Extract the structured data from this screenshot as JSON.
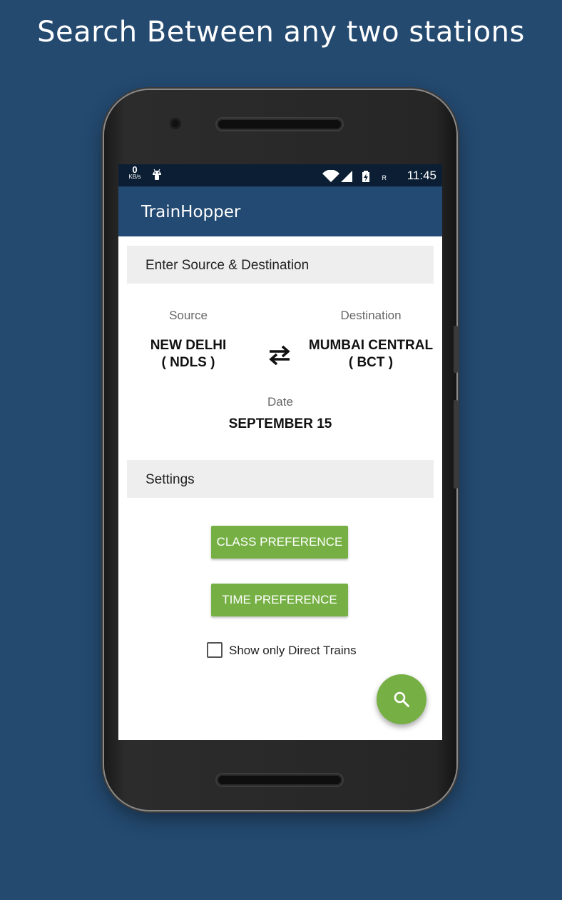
{
  "headline": "Search Between any two stations",
  "status_bar": {
    "data_rate_value": "0",
    "data_rate_unit": "KB/s",
    "network_label": "R",
    "time": "11:45"
  },
  "app_bar": {
    "title": "TrainHopper"
  },
  "route_section": {
    "header": "Enter Source & Destination",
    "source_label": "Source",
    "source_station": "NEW DELHI",
    "source_code": "( NDLS )",
    "destination_label": "Destination",
    "destination_station": "MUMBAI CENTRAL",
    "destination_code": "( BCT )",
    "date_label": "Date",
    "date_value": "SEPTEMBER 15"
  },
  "settings_section": {
    "header": "Settings",
    "class_button": "CLASS PREFERENCE",
    "time_button": "TIME PREFERENCE",
    "direct_trains_label": "Show only Direct Trains",
    "direct_trains_checked": false
  },
  "colors": {
    "background": "#244a70",
    "app_bar": "#234a72",
    "status_bar": "#0b1e33",
    "accent_green": "#76b045",
    "section_header_bg": "#eeeeee"
  },
  "icons": {
    "swap": "swap-arrows-icon",
    "search_fab": "search-icon",
    "notification": "android-debug-icon",
    "wifi": "wifi-icon",
    "signal": "cell-signal-icon",
    "battery": "battery-charging-icon"
  }
}
